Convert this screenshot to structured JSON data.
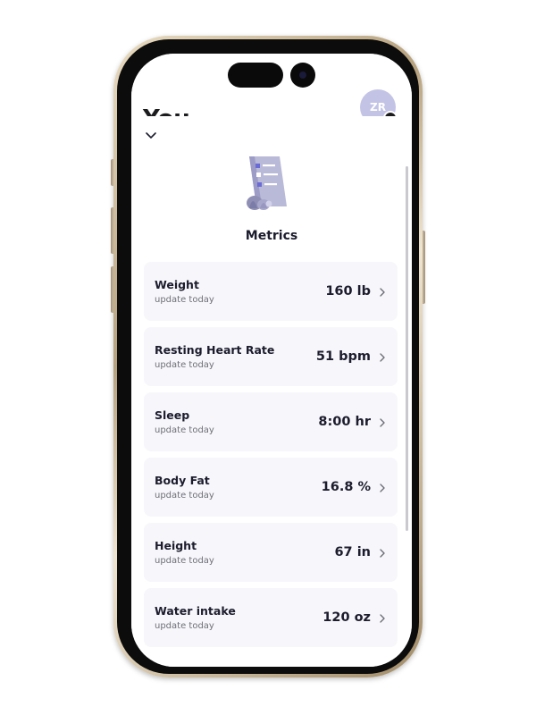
{
  "background_app": {
    "title": "You",
    "avatar_initials": "ZR"
  },
  "sheet": {
    "title": "Metrics",
    "metrics": [
      {
        "name": "Weight",
        "subtitle": "update today",
        "value": "160 lb"
      },
      {
        "name": "Resting Heart Rate",
        "subtitle": "update today",
        "value": "51 bpm"
      },
      {
        "name": "Sleep",
        "subtitle": "update today",
        "value": "8:00 hr"
      },
      {
        "name": "Body Fat",
        "subtitle": "update today",
        "value": "16.8 %"
      },
      {
        "name": "Height",
        "subtitle": "update today",
        "value": "67 in"
      },
      {
        "name": "Water intake",
        "subtitle": "update today",
        "value": "120 oz"
      }
    ]
  },
  "icons": {
    "collapse": "chevron-down-icon",
    "row_action": "chevron-right-icon",
    "illustration": "clipboard-list-illustration"
  },
  "colors": {
    "accent": "#6b6bd6",
    "avatar": "#c3c3e6",
    "card_background": "#f7f7fb",
    "text_primary": "#1c1c2e",
    "text_secondary": "#6e6e78"
  }
}
